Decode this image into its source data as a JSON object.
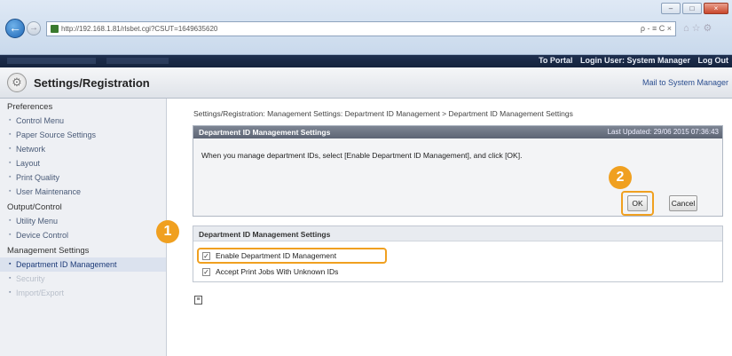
{
  "browser": {
    "url": "http://192.168.1.81/rlsbet.cgi?CSUT=1649635620",
    "address_tools": "ρ - ≡ C ×",
    "window_controls": {
      "minimize": "–",
      "maximize": "□",
      "close": "×"
    }
  },
  "header": {
    "links": [
      "To Portal",
      "Login User: System Manager",
      "Log Out"
    ]
  },
  "title_bar": {
    "title": "Settings/Registration",
    "mail_link": "Mail to System Manager"
  },
  "sidebar": {
    "sections": [
      {
        "label": "Preferences",
        "items": [
          "Control Menu",
          "Paper Source Settings",
          "Network",
          "Layout",
          "Print Quality",
          "User Maintenance"
        ]
      },
      {
        "label": "Output/Control",
        "items": [
          "Utility Menu",
          "Device Control"
        ]
      },
      {
        "label": "Management Settings",
        "items": [
          "Department ID Management",
          "Security",
          "Import/Export"
        ]
      }
    ],
    "active_item": "Department ID Management"
  },
  "content": {
    "breadcrumb": "Settings/Registration: Management Settings: Department ID Management > Department ID Management Settings",
    "panel_title": "Department ID Management Settings",
    "last_updated": "Last Updated: 29/06 2015 07:36:43",
    "instruction": "When you manage department IDs, select [Enable Department ID Management], and click [OK].",
    "ok_label": "OK",
    "cancel_label": "Cancel",
    "settings_title": "Department ID Management Settings",
    "checkbox1_label": "Enable Department ID Management",
    "checkbox1_checked": true,
    "checkbox2_label": "Accept Print Jobs With Unknown IDs",
    "checkbox2_checked": true,
    "check_mark": "✓"
  },
  "callouts": {
    "step1": "1",
    "step2": "2"
  },
  "colors": {
    "callout": "#f0a020",
    "header_bg": "#1e2f4f",
    "panel_head": "#6a7280"
  }
}
